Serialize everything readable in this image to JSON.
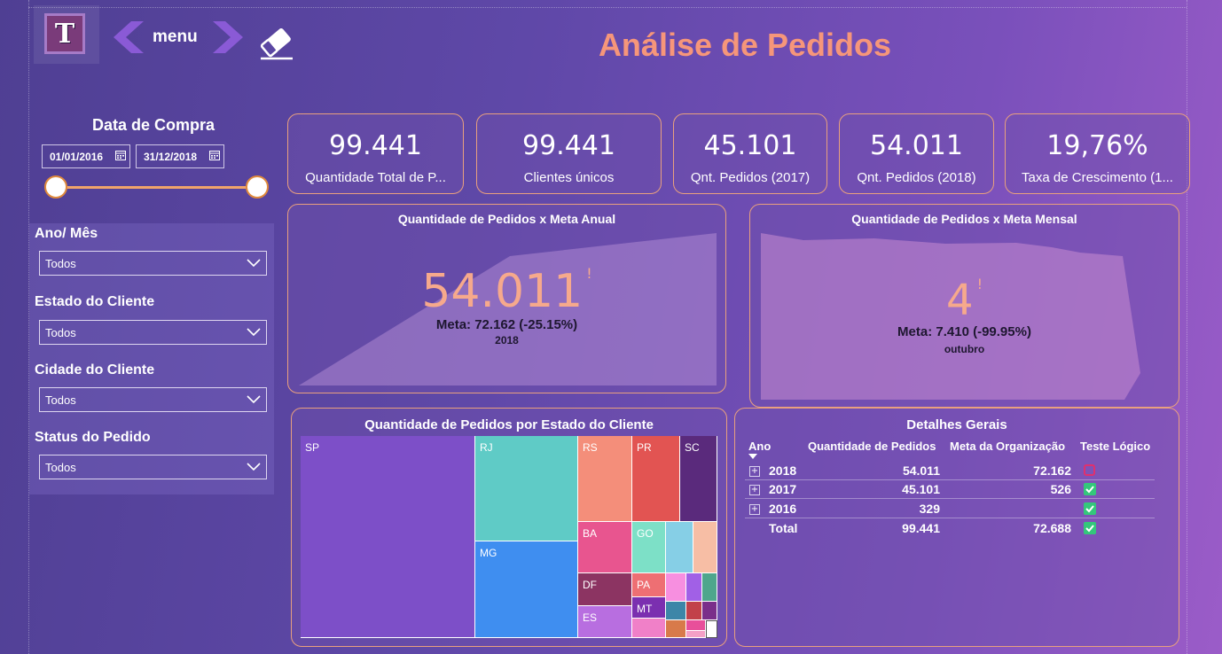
{
  "header": {
    "menu_label": "menu",
    "logo_letter": "T",
    "title": "Análise de Pedidos"
  },
  "date_filter": {
    "title": "Data de Compra",
    "start": "01/01/2016",
    "end": "31/12/2018"
  },
  "filters": [
    {
      "label": "Ano/ Mês",
      "value": "Todos"
    },
    {
      "label": "Estado do Cliente",
      "value": "Todos"
    },
    {
      "label": "Cidade do Cliente",
      "value": "Todos"
    },
    {
      "label": "Status do Pedido",
      "value": "Todos"
    }
  ],
  "kpis": [
    {
      "value": "99.441",
      "label": "Quantidade Total de P..."
    },
    {
      "value": "99.441",
      "label": "Clientes únicos"
    },
    {
      "value": "45.101",
      "label": "Qnt. Pedidos (2017)"
    },
    {
      "value": "54.011",
      "label": "Qnt. Pedidos (2018)"
    },
    {
      "value": "19,76%",
      "label": "Taxa de Crescimento (1..."
    }
  ],
  "annual_goal": {
    "title": "Quantidade de Pedidos x Meta Anual",
    "value": "54.011",
    "flag": "!",
    "meta": "Meta: 72.162 (-25.15%)",
    "period": "2018"
  },
  "monthly_goal": {
    "title": "Quantidade de Pedidos x Meta Mensal",
    "value": "4",
    "flag": "!",
    "meta": "Meta: 7.410 (-99.95%)",
    "period": "outubro"
  },
  "treemap": {
    "title": "Quantidade de Pedidos por Estado do Cliente",
    "labels": {
      "SP": "SP",
      "RJ": "RJ",
      "MG": "MG",
      "RS": "RS",
      "PR": "PR",
      "SC": "SC",
      "BA": "BA",
      "GO": "GO",
      "DF": "DF",
      "PA": "PA",
      "ES": "ES",
      "MT": "MT"
    }
  },
  "details": {
    "title": "Detalhes Gerais",
    "columns": [
      "Ano",
      "Quantidade de Pedidos",
      "Meta da Organização",
      "Teste Lógico"
    ],
    "rows": [
      {
        "ano": "2018",
        "qtd": "54.011",
        "meta": "72.162",
        "ok": false
      },
      {
        "ano": "2017",
        "qtd": "45.101",
        "meta": "526",
        "ok": true
      },
      {
        "ano": "2016",
        "qtd": "329",
        "meta": "",
        "ok": true
      }
    ],
    "total": {
      "ano": "Total",
      "qtd": "99.441",
      "meta": "72.688",
      "ok": true
    }
  },
  "colors": {
    "title": "#f6967a",
    "card_border": "#e9a07e",
    "check": "#34c77b",
    "fail": "#e0306e"
  }
}
